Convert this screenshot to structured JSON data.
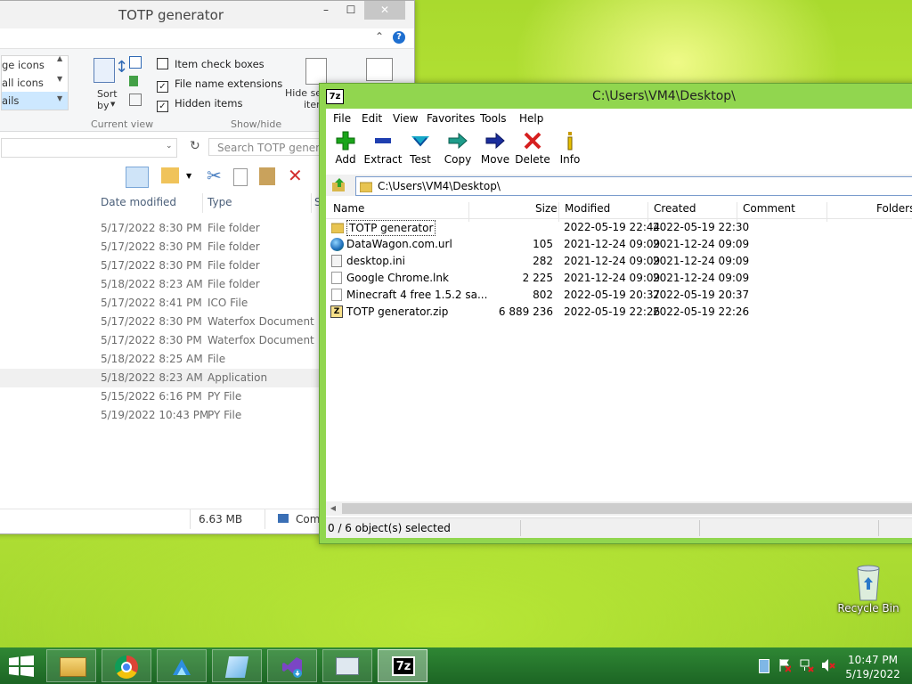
{
  "explorer": {
    "title": "TOTP generator",
    "window_buttons": {
      "minimize": "–",
      "maximize": "☐",
      "close": "✕"
    },
    "layout_items": [
      "ge icons",
      "all icons",
      "ails"
    ],
    "sort_label": "Sort",
    "sort_by": "by",
    "current_view_group": "Current view",
    "checkboxes": [
      {
        "label": "Item check boxes",
        "checked": false
      },
      {
        "label": "File name extensions",
        "checked": true
      },
      {
        "label": "Hidden items",
        "checked": true
      }
    ],
    "hide_selected_line1": "Hide se",
    "hide_selected_line2": "item",
    "show_hide_group": "Show/hide",
    "search_placeholder": "Search TOTP genera",
    "columns": {
      "date_modified": "Date modified",
      "type": "Type",
      "size": "S"
    },
    "rows": [
      {
        "date": "5/17/2022 8:30 PM",
        "type": "File folder"
      },
      {
        "date": "5/17/2022 8:30 PM",
        "type": "File folder"
      },
      {
        "date": "5/17/2022 8:30 PM",
        "type": "File folder"
      },
      {
        "date": "5/18/2022 8:23 AM",
        "type": "File folder"
      },
      {
        "date": "5/17/2022 8:41 PM",
        "type": "ICO File"
      },
      {
        "date": "5/17/2022 8:30 PM",
        "type": "Waterfox Document"
      },
      {
        "date": "5/17/2022 8:30 PM",
        "type": "Waterfox Document"
      },
      {
        "date": "5/18/2022 8:25 AM",
        "type": "File"
      },
      {
        "date": "5/18/2022 8:23 AM",
        "type": "Application"
      },
      {
        "date": "5/15/2022 6:16 PM",
        "type": "PY File"
      },
      {
        "date": "5/19/2022 10:43 PM",
        "type": "PY File"
      }
    ],
    "status_size": "6.63 MB",
    "status_computer": "Com"
  },
  "sevenzip": {
    "title": "C:\\Users\\VM4\\Desktop\\",
    "app_icon_text": "7z",
    "menu": [
      "File",
      "Edit",
      "View",
      "Favorites",
      "Tools",
      "Help"
    ],
    "toolbar": [
      {
        "label": "Add",
        "icon": "add-icon"
      },
      {
        "label": "Extract",
        "icon": "extract-icon"
      },
      {
        "label": "Test",
        "icon": "test-icon"
      },
      {
        "label": "Copy",
        "icon": "copy-icon"
      },
      {
        "label": "Move",
        "icon": "move-icon"
      },
      {
        "label": "Delete",
        "icon": "delete-icon"
      },
      {
        "label": "Info",
        "icon": "info-icon"
      }
    ],
    "path": "C:\\Users\\VM4\\Desktop\\",
    "columns": {
      "name": "Name",
      "size": "Size",
      "modified": "Modified",
      "created": "Created",
      "comment": "Comment",
      "folders": "Folders"
    },
    "rows": [
      {
        "name": "TOTP generator",
        "size": "",
        "modified": "2022-05-19 22:44",
        "created": "2022-05-19 22:30",
        "icon": "folder-icon"
      },
      {
        "name": "DataWagon.com.url",
        "size": "105",
        "modified": "2021-12-24 09:09",
        "created": "2021-12-24 09:09",
        "icon": "globe-icon"
      },
      {
        "name": "desktop.ini",
        "size": "282",
        "modified": "2021-12-24 09:09",
        "created": "2021-12-24 09:09",
        "icon": "settings-file-icon"
      },
      {
        "name": "Google Chrome.lnk",
        "size": "2 225",
        "modified": "2021-12-24 09:09",
        "created": "2021-12-24 09:09",
        "icon": "file-icon"
      },
      {
        "name": "Minecraft 4 free 1.5.2 sa...",
        "size": "802",
        "modified": "2022-05-19 20:37",
        "created": "2022-05-19 20:37",
        "icon": "file-icon"
      },
      {
        "name": "TOTP generator.zip",
        "size": "6 889 236",
        "modified": "2022-05-19 22:26",
        "created": "2022-05-19 22:26",
        "icon": "zip-icon"
      }
    ],
    "status": "0 / 6 object(s) selected"
  },
  "desktop": {
    "recycle_bin": "Recycle Bin"
  },
  "taskbar": {
    "apps": [
      "file-explorer",
      "chrome",
      "waterfox",
      "notepad",
      "visual-studio-installer",
      "task-manager",
      "7-zip"
    ],
    "active_app": "7-zip",
    "seven_zip_text": "7z",
    "time": "10:47 PM",
    "date": "5/19/2022"
  }
}
